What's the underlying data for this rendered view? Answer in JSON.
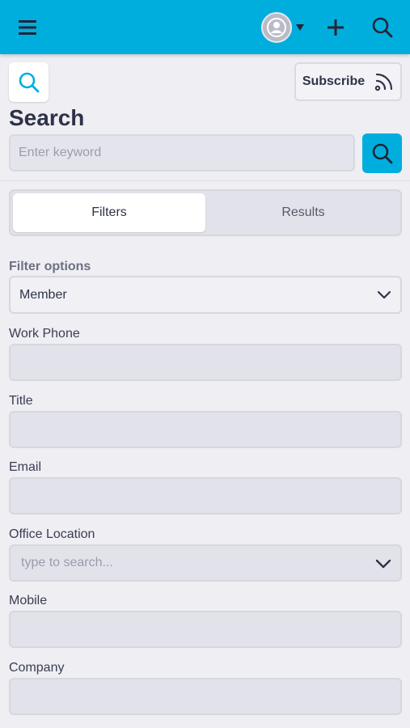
{
  "header": {
    "menu_icon": "hamburger-menu-icon",
    "avatar_icon": "user-avatar-icon",
    "add_icon": "plus-icon",
    "search_icon": "search-icon",
    "background_color": "#00aede"
  },
  "toolbar": {
    "subscribe_label": "Subscribe",
    "subscribe_icon": "rss-feed-icon"
  },
  "page": {
    "title": "Search"
  },
  "search": {
    "placeholder": "Enter keyword",
    "value": ""
  },
  "tabs": [
    {
      "label": "Filters",
      "active": true
    },
    {
      "label": "Results",
      "active": false
    }
  ],
  "filters": {
    "filter_options_label": "Filter options",
    "filter_options_value": "Member",
    "fields": [
      {
        "label": "Work Phone",
        "value": ""
      },
      {
        "label": "Title",
        "value": ""
      },
      {
        "label": "Email",
        "value": ""
      },
      {
        "label": "Office Location",
        "placeholder": "type to search..."
      },
      {
        "label": "Mobile",
        "value": ""
      },
      {
        "label": "Company",
        "value": ""
      }
    ]
  },
  "colors": {
    "accent": "#00aede",
    "background": "#eeeef3"
  }
}
